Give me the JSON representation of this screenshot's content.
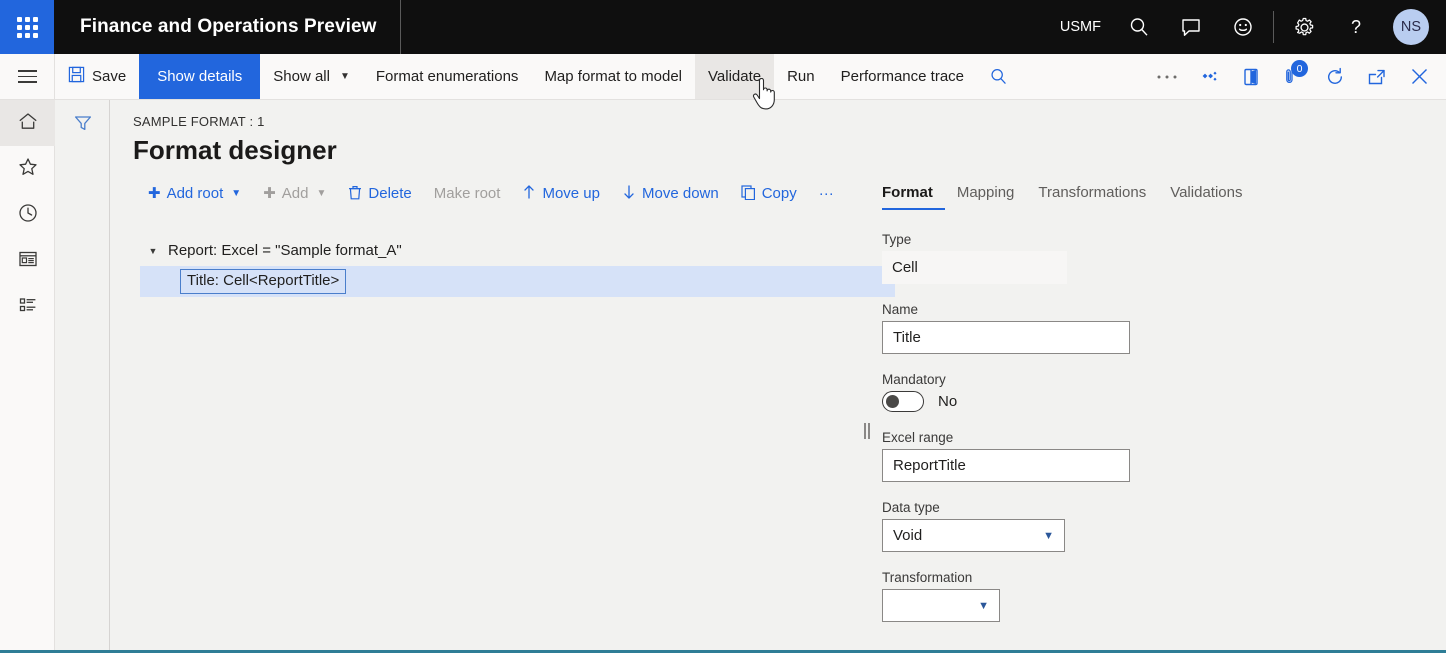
{
  "topbar": {
    "app_title": "Finance and Operations Preview",
    "company": "USMF",
    "icons": [
      "waffle-icon",
      "search-icon",
      "message-icon",
      "feedback-icon",
      "settings-icon",
      "help-icon"
    ],
    "avatar_initials": "NS",
    "accent_color": "#2266dd",
    "background_color": "#0f0f0f"
  },
  "commandbar": {
    "save_label": "Save",
    "show_details_label": "Show details",
    "show_all_label": "Show all",
    "format_enumerations_label": "Format enumerations",
    "map_format_to_model_label": "Map format to model",
    "validate_label": "Validate",
    "run_label": "Run",
    "performance_trace_label": "Performance trace",
    "overflow_label": "...",
    "notification_count": "0",
    "hovered_button": "Validate",
    "selected_button": "Show details"
  },
  "rail": {
    "items": [
      {
        "name": "hamburger-icon",
        "label": "Menu"
      },
      {
        "name": "home-icon",
        "label": "Home",
        "active": true
      },
      {
        "name": "star-icon",
        "label": "Favorites"
      },
      {
        "name": "clock-icon",
        "label": "Recent"
      },
      {
        "name": "workspace-icon",
        "label": "Workspaces"
      },
      {
        "name": "modules-icon",
        "label": "Modules"
      }
    ]
  },
  "filter": {
    "icon": "filter-icon"
  },
  "page": {
    "caption": "SAMPLE FORMAT : 1",
    "title": "Format designer"
  },
  "actions": [
    {
      "label": "Add root",
      "icon": "plus-icon",
      "chevron": true,
      "disabled": false
    },
    {
      "label": "Add",
      "icon": "plus-icon",
      "chevron": true,
      "disabled": true
    },
    {
      "label": "Delete",
      "icon": "trash-icon",
      "chevron": false,
      "disabled": false
    },
    {
      "label": "Make root",
      "icon": "",
      "chevron": false,
      "disabled": true
    },
    {
      "label": "Move up",
      "icon": "arrow-up-icon",
      "chevron": false,
      "disabled": false
    },
    {
      "label": "Move down",
      "icon": "arrow-down-icon",
      "chevron": false,
      "disabled": false
    },
    {
      "label": "Copy",
      "icon": "copy-icon",
      "chevron": false,
      "disabled": false
    },
    {
      "label": "···",
      "icon": "",
      "chevron": false,
      "disabled": false
    }
  ],
  "tree": {
    "root": {
      "label": "Report: Excel = \"Sample format_A\"",
      "expanded": true
    },
    "child": {
      "label": "Title: Cell<ReportTitle>",
      "selected": true,
      "highlight_color": "#d6e2f8"
    }
  },
  "properties": {
    "tabs": [
      {
        "label": "Format",
        "active": true
      },
      {
        "label": "Mapping",
        "active": false
      },
      {
        "label": "Transformations",
        "active": false
      },
      {
        "label": "Validations",
        "active": false
      }
    ],
    "fields": {
      "type": {
        "label": "Type",
        "value": "Cell",
        "readonly": true
      },
      "name": {
        "label": "Name",
        "value": "Title"
      },
      "mandatory": {
        "label": "Mandatory",
        "value": "No",
        "on": false
      },
      "excel_range": {
        "label": "Excel range",
        "value": "ReportTitle"
      },
      "data_type": {
        "label": "Data type",
        "value": "Void"
      },
      "transformation": {
        "label": "Transformation",
        "value": ""
      }
    }
  }
}
